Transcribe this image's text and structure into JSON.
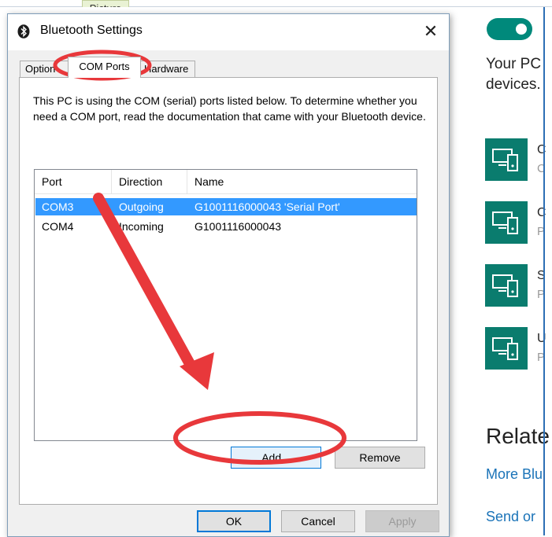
{
  "background": {
    "picture_tab": "Picture",
    "description": "Your PC\ndevices.",
    "description_lines": [
      "Your PC",
      "devices."
    ],
    "devices": [
      {
        "name": "C",
        "status": "C"
      },
      {
        "name": "C",
        "status": "P"
      },
      {
        "name": "S",
        "status": "P"
      },
      {
        "name": "U",
        "status": "P"
      }
    ],
    "related_heading": "Relate",
    "links": [
      "More Blu",
      "Send or"
    ]
  },
  "dialog": {
    "title": "Bluetooth Settings",
    "close_glyph": "✕",
    "tabs": [
      "Option",
      "COM Ports",
      "Hardware"
    ],
    "active_tab": "COM Ports",
    "description": "This PC is using the COM (serial) ports listed below. To determine whether you need a COM port, read the documentation that came with your Bluetooth device.",
    "columns": [
      "Port",
      "Direction",
      "Name"
    ],
    "rows": [
      {
        "port": "COM3",
        "direction": "Outgoing",
        "name": "G1001116000043 'Serial Port'",
        "selected": true
      },
      {
        "port": "COM4",
        "direction": "Incoming",
        "name": "G1001116000043",
        "selected": false
      }
    ],
    "buttons": {
      "add": "Add...",
      "remove": "Remove",
      "ok": "OK",
      "cancel": "Cancel",
      "apply": "Apply"
    }
  },
  "colors": {
    "accent_teal": "#0a7c6e",
    "selection_blue": "#3399ff",
    "annotation_red": "#e8383b"
  }
}
